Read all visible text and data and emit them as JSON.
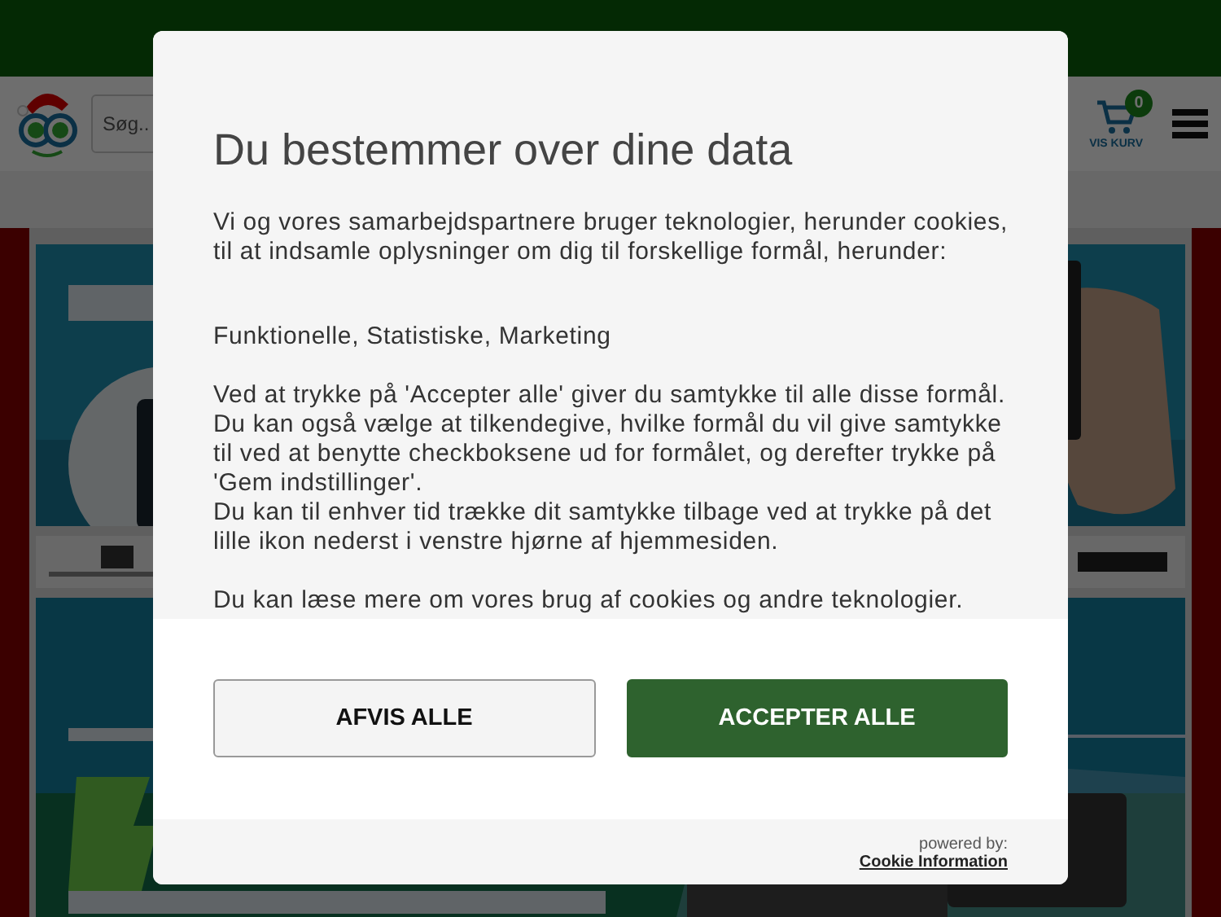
{
  "site": {
    "search": {
      "placeholder": "Søg.."
    },
    "cart": {
      "count": "0",
      "label": "VIS KURV"
    }
  },
  "dialog": {
    "title": "Du bestemmer over dine data",
    "sections": [
      [
        "Vi og vores samarbejdspartnere bruger teknologier, herunder cookies, til at indsamle oplysninger om dig til forskellige formål, herunder:"
      ],
      [
        "Funktionelle, Statistiske, Marketing"
      ],
      [
        "Ved at trykke på 'Accepter alle' giver du samtykke til alle disse formål. Du kan også vælge at tilkendegive, hvilke formål du vil give samtykke til ved at benytte checkboksene ud for formålet, og derefter trykke på 'Gem indstillinger'.",
        "Du kan til enhver tid trække dit samtykke tilbage ved at trykke på det lille ikon nederst i venstre hjørne af hjemmesiden."
      ],
      [
        "Du kan læse mere om vores brug af cookies og andre teknologier."
      ]
    ],
    "buttons": [
      {
        "label": "AFVIS ALLE",
        "kind": "secondary"
      },
      {
        "label": "ACCEPTER ALLE",
        "kind": "primary"
      }
    ],
    "powered_by": "powered by:",
    "provider_link": "Cookie Information"
  }
}
